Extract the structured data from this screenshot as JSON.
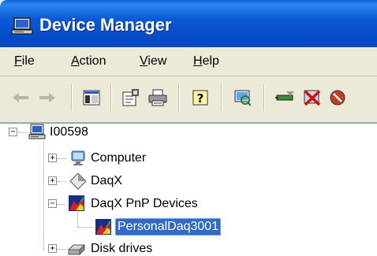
{
  "window": {
    "title": "Device Manager"
  },
  "menu": [
    {
      "accel": "F",
      "rest": "ile"
    },
    {
      "accel": "A",
      "rest": "ction"
    },
    {
      "accel": "V",
      "rest": "iew"
    },
    {
      "accel": "H",
      "rest": "elp"
    }
  ],
  "tree": {
    "root": "I00598",
    "nodes": [
      {
        "label": "Computer"
      },
      {
        "label": "DaqX"
      },
      {
        "label": "DaqX PnP Devices"
      },
      {
        "label": "PersonalDaq3001"
      },
      {
        "label": "Disk drives"
      }
    ]
  }
}
